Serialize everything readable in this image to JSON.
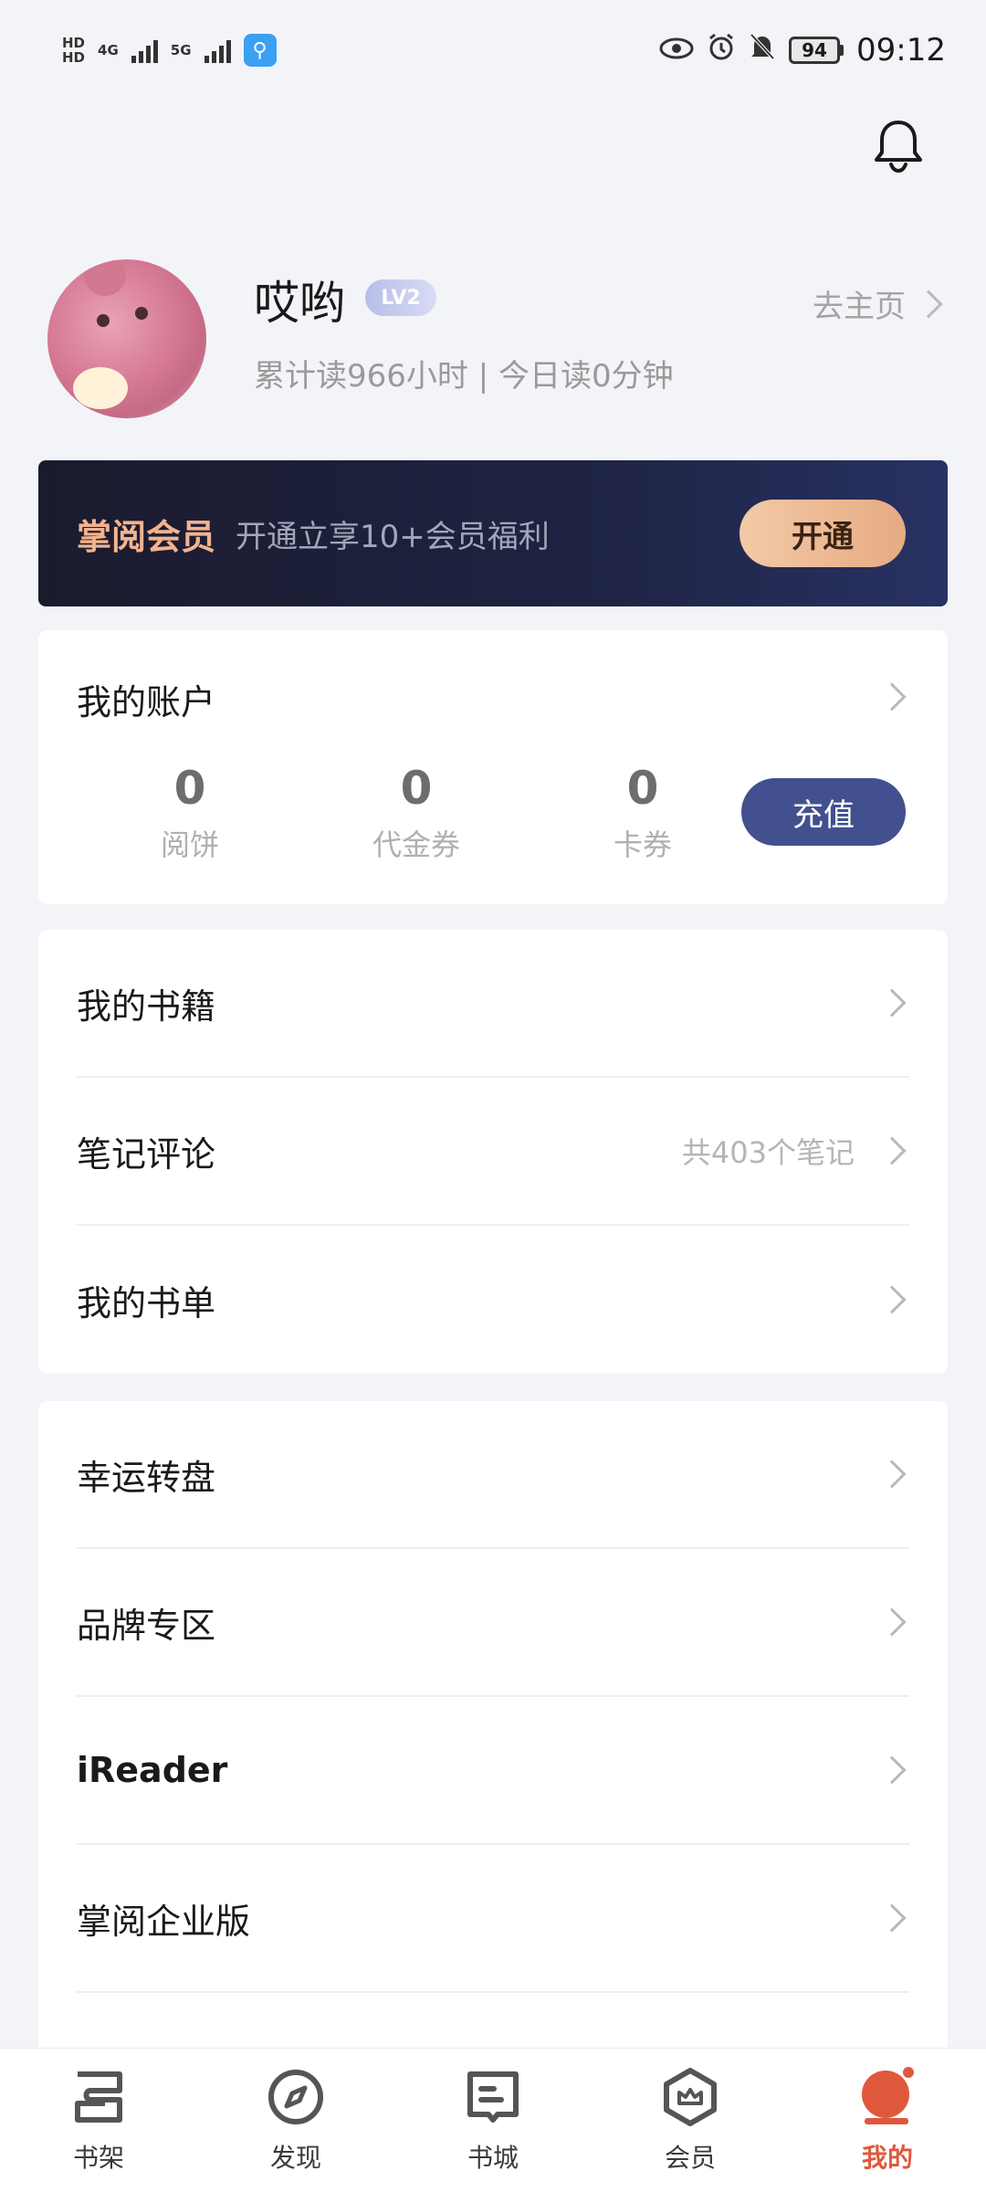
{
  "status_bar": {
    "left_labels": [
      "HD",
      "HD",
      "4G",
      "5G"
    ],
    "battery": "94",
    "time": "09:12",
    "icons": [
      "eye-icon",
      "alarm-icon",
      "mute-bell-icon",
      "battery-icon"
    ]
  },
  "profile": {
    "username": "哎哟",
    "level": "LV2",
    "stats_text": "累计读966小时 | 今日读0分钟",
    "home_link": "去主页"
  },
  "vip_banner": {
    "title": "掌阅会员",
    "description": "开通立享10+会员福利",
    "button": "开通"
  },
  "account": {
    "title": "我的账户",
    "stats": [
      {
        "value": "0",
        "label": "阅饼"
      },
      {
        "value": "0",
        "label": "代金券"
      },
      {
        "value": "0",
        "label": "卡券"
      }
    ],
    "recharge_button": "充值"
  },
  "menu_group_1": [
    {
      "label": "我的书籍",
      "detail": ""
    },
    {
      "label": "笔记评论",
      "detail": "共403个笔记"
    },
    {
      "label": "我的书单",
      "detail": ""
    }
  ],
  "menu_group_2": [
    {
      "label": "幸运转盘"
    },
    {
      "label": "品牌专区"
    },
    {
      "label": "iReader"
    },
    {
      "label": "掌阅企业版"
    }
  ],
  "bottom_nav": [
    {
      "label": "书架",
      "icon": "bookshelf-icon"
    },
    {
      "label": "发现",
      "icon": "compass-icon"
    },
    {
      "label": "书城",
      "icon": "book-store-icon"
    },
    {
      "label": "会员",
      "icon": "crown-icon"
    },
    {
      "label": "我的",
      "icon": "profile-icon",
      "active": true
    }
  ],
  "colors": {
    "accent": "#e0583c",
    "vip_gold": "#f2b38d",
    "recharge_blue": "#43508f",
    "banner_dark": "#1e2342"
  }
}
